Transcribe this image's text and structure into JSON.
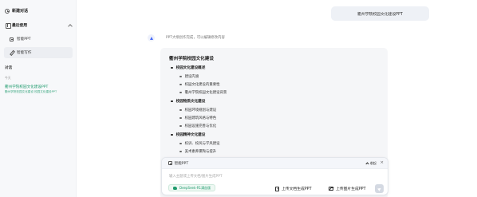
{
  "sidebar": {
    "new_chat_label": "新建对话",
    "recent_label": "最近使用",
    "items": [
      {
        "label": "智能PPT",
        "icon": "ppt-icon"
      },
      {
        "label": "智能写作",
        "icon": "pen-icon"
      }
    ],
    "conversations_label": "对话",
    "date_group": "今天",
    "conversation": {
      "title": "衢州学院校园文化建设PPT",
      "subtitle": "衢州学院校园文化建设 校园文化建设PPT"
    }
  },
  "chat": {
    "user_message": "衢州学院校园文化建设PPT",
    "bot_note": "PPT大纲创作完成，可以编辑修改内容",
    "outline": {
      "title": "衢州学院校园文化建设",
      "sections": [
        {
          "heading": "校园文化建设概述",
          "items": [
            "建设内涵",
            "校园文化建设的重要性",
            "衢州学院校园文化建设背景"
          ]
        },
        {
          "heading": "校园物质文化建设",
          "items": [
            "校园环境规划与建设",
            "校园建筑风格与特色",
            "校园设施完善与优化"
          ]
        },
        {
          "heading": "校园精神文化建设",
          "items": [
            "校训、校风与学风建设",
            "美术素养熏陶与提升"
          ]
        }
      ]
    }
  },
  "composer": {
    "mode_label": "智能PPT",
    "collapse_label": "收起",
    "close_glyph": "×",
    "placeholder": "输入主题或上传文档/图片生成PPT",
    "model_label": "DeepSeek-R1满血版",
    "upload_doc_label": "上传文档生成PPT",
    "upload_image_label": "上传图片生成PPT"
  },
  "colors": {
    "accent_green": "#1d9a6c",
    "bot_blue": "#4a6cf7",
    "sidebar_bg": "#f7f8fa"
  }
}
